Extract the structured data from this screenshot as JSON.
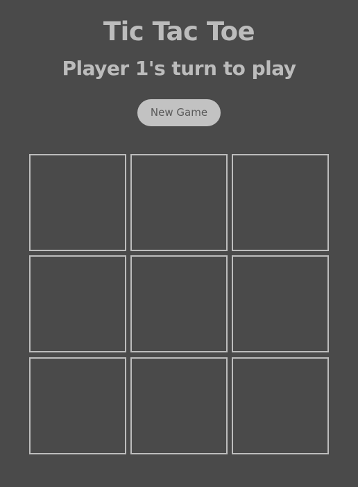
{
  "game": {
    "title": "Tic Tac Toe",
    "status": "Player 1's turn to play",
    "new_game_label": "New Game",
    "board": [
      "",
      "",
      "",
      "",
      "",
      "",
      "",
      "",
      ""
    ]
  },
  "colors": {
    "background": "#4a4a4a",
    "text": "#bcbcbc",
    "button_bg": "#c2c2c2",
    "button_text": "#5a5a5a",
    "cell_border": "#bdbdbd"
  }
}
